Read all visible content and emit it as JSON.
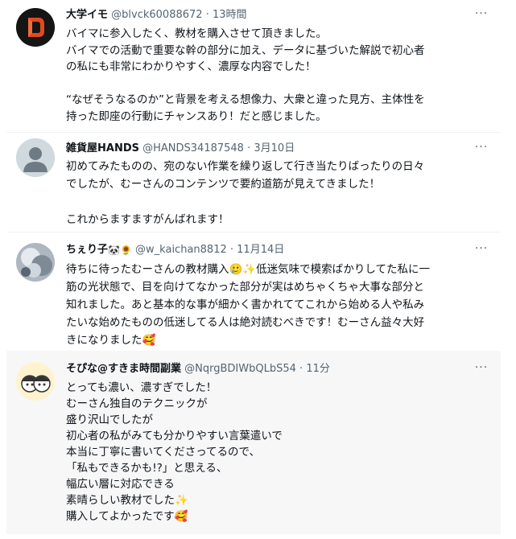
{
  "tweets": [
    {
      "name": "大学イモ",
      "handle": "@blvck60088672",
      "time": "13時間",
      "lines": [
        "バイマに参入したく、教材を購入させて頂きました。",
        "バイマでの活動で重要な幹の部分に加え、データに基づいた解説で初心者",
        "の私にも非常にわかりやすく、濃厚な内容でした！",
        "",
        "“なぜそうなるのか”と背景を考える想像力、大衆と違った見方、主体性を",
        "持った即座の行動にチャンスあり！だと感じました。"
      ]
    },
    {
      "name": "雑貨屋HANDS",
      "handle": "@HANDS34187548",
      "time": "3月10日",
      "lines": [
        "初めてみたものの、宛のない作業を繰り返して行き当たりばったりの日々",
        "でしたが、むーさんのコンテンツで要約道筋が見えてきました！",
        "",
        "これからますますがんばれます！"
      ]
    },
    {
      "name": "ちぇり子",
      "name_emoji": "🐼🌻",
      "handle": "@w_kaichan8812",
      "time": "11月14日",
      "lines": [
        "待ちに待ったむーさんの教材購入🥲✨低迷気味で模索ばかりしてた私に一",
        "筋の光状態で、目を向けてなかった部分が実はめちゃくちゃ大事な部分と",
        "知れました。あと基本的な事が細かく書かれててこれから始める人や私み",
        "たいな始めたものの低迷してる人は絶対読むべきです！むーさん益々大好",
        "きになりました🥰"
      ]
    },
    {
      "name": "そぴな@すきま時間副業",
      "handle": "@NqrgBDIWbQLbS54",
      "time": "11分",
      "lines": [
        "とっても濃い、濃すぎでした！",
        "むーさん独自のテクニックが",
        "盛り沢山でしたが",
        "初心者の私がみても分かりやすい言葉遣いで",
        "本当に丁寧に書いてくださってるので、",
        "「私もできるかも!?」と思える、",
        "幅広い層に対応できる",
        "素晴らしい教材でした✨",
        "購入してよかったです🥰"
      ]
    }
  ],
  "more_icon": "more-horizontal-icon",
  "separator": "·"
}
